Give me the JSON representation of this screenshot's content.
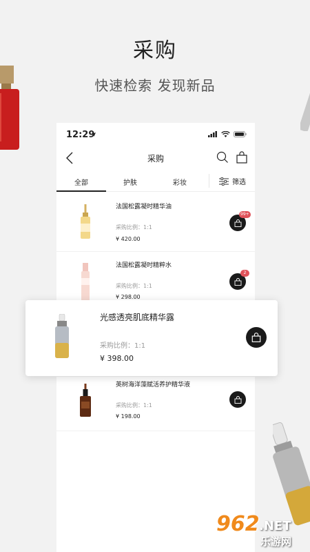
{
  "promo": {
    "title": "采购",
    "subtitle": "快速检索 发现新品"
  },
  "status_bar": {
    "time": "12:29",
    "icons": [
      "location-arrow-icon",
      "signal-icon",
      "wifi-icon",
      "battery-icon"
    ]
  },
  "nav": {
    "title": "采购",
    "icons": [
      "back-chevron-icon",
      "search-icon",
      "shopping-bag-icon"
    ]
  },
  "tabs": [
    {
      "label": "全部",
      "active": true
    },
    {
      "label": "护肤",
      "active": false
    },
    {
      "label": "彩妆",
      "active": false
    }
  ],
  "filter": {
    "label": "筛选",
    "icon": "filter-sliders-icon"
  },
  "products": [
    {
      "name": "法国松露凝时精华油",
      "ratio": "采购比例：1:1",
      "price": "¥ 420.00",
      "badge": "99+"
    },
    {
      "name": "法国松露凝时精粹水",
      "ratio": "采购比例：1:1",
      "price": "¥ 298.00",
      "badge": "2"
    },
    {
      "name": "光感透亮肌底精华露",
      "ratio": "采购比例：1:1",
      "price": "¥ 398.00",
      "badge": ""
    },
    {
      "name": "英树海洋藻赋活养护精华液",
      "ratio": "采购比例：1:1",
      "price": "¥ 198.00",
      "badge": ""
    }
  ],
  "watermark": {
    "brand": "962",
    "suffix": ".NET",
    "site": "乐游网"
  },
  "colors": {
    "background": "#f2f2f2",
    "button": "#1a1a1a",
    "badge": "#e0525a",
    "watermark_orange": "#f08a1c"
  }
}
